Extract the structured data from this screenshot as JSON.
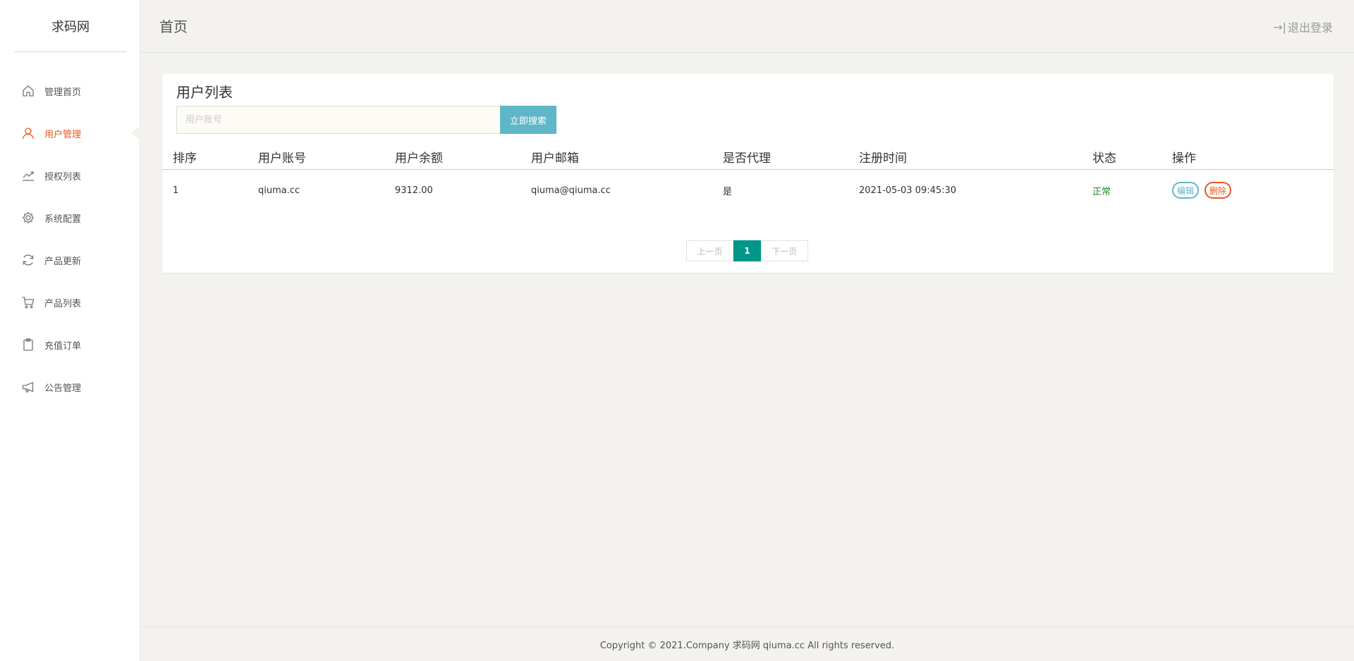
{
  "sidebar": {
    "brand": "求码网",
    "items": [
      {
        "label": "管理首页",
        "icon": "home-icon",
        "active": false
      },
      {
        "label": "用户管理",
        "icon": "user-icon",
        "active": true
      },
      {
        "label": "授权列表",
        "icon": "trend-icon",
        "active": false
      },
      {
        "label": "系统配置",
        "icon": "gear-icon",
        "active": false
      },
      {
        "label": "产品更新",
        "icon": "refresh-icon",
        "active": false
      },
      {
        "label": "产品列表",
        "icon": "cart-icon",
        "active": false
      },
      {
        "label": "充值订单",
        "icon": "clipboard-icon",
        "active": false
      },
      {
        "label": "公告管理",
        "icon": "megaphone-icon",
        "active": false
      }
    ]
  },
  "header": {
    "title": "首页",
    "logout_icon": "→|",
    "logout_label": "退出登录"
  },
  "card": {
    "title": "用户列表",
    "search": {
      "placeholder": "用户账号",
      "value": "",
      "button_label": "立即搜索"
    },
    "table": {
      "columns": [
        "排序",
        "用户账号",
        "用户余额",
        "用户邮箱",
        "是否代理",
        "注册时间",
        "状态",
        "操作"
      ],
      "rows": [
        {
          "order": "1",
          "account": "qiuma.cc",
          "balance": "9312.00",
          "email": "qiuma@qiuma.cc",
          "agent": "是",
          "registered": "2021-05-03 09:45:30",
          "status": "正常",
          "edit_label": "编辑",
          "delete_label": "删除"
        }
      ]
    },
    "pagination": {
      "prev_label": "上一页",
      "current": "1",
      "next_label": "下一页"
    }
  },
  "footer": {
    "text": "Copyright © 2021.Company 求码网 qiuma.cc All rights reserved."
  },
  "colors": {
    "accent": "#e8571c",
    "button": "#5fb6c6",
    "pager_active": "#009688",
    "status_ok": "#1e8a2a"
  }
}
